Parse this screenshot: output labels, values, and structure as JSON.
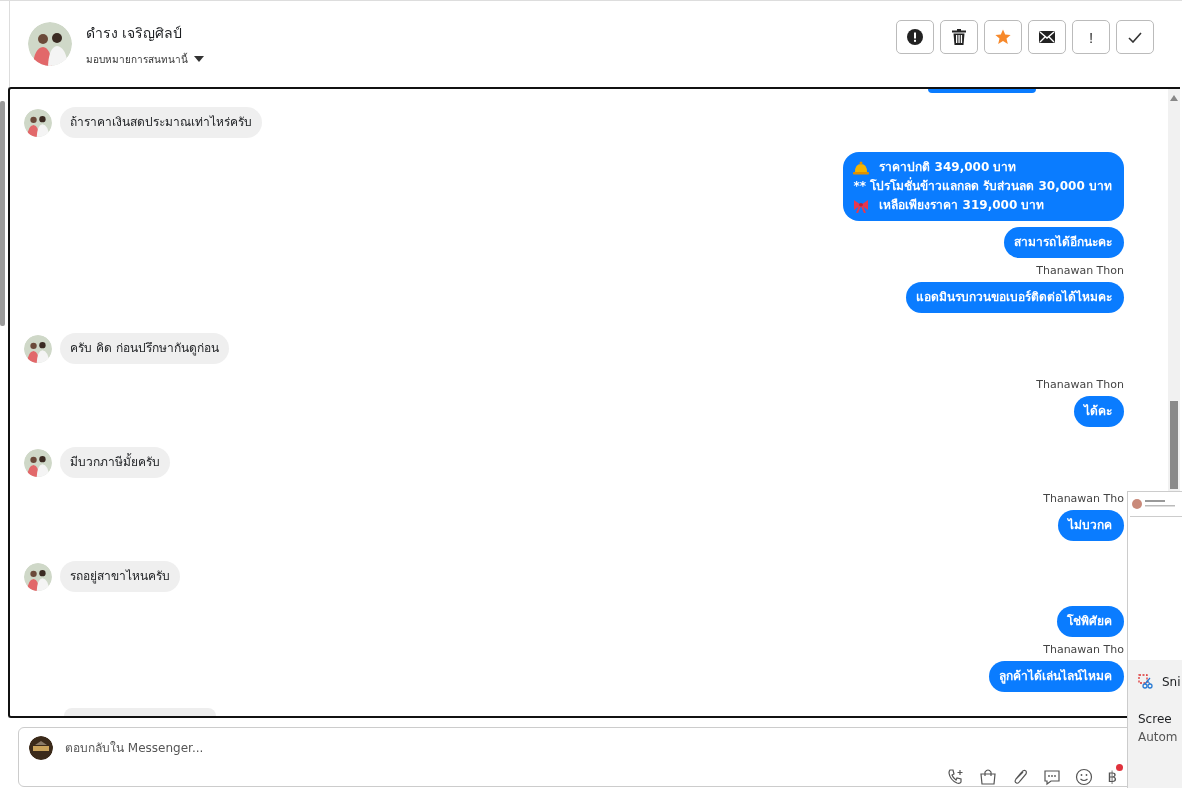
{
  "header": {
    "name": "ดำรง เจริญศิลป์",
    "assign_label": "มอบหมายการสนทนานี้",
    "actions": [
      {
        "kind": "report"
      },
      {
        "kind": "delete"
      },
      {
        "kind": "star",
        "on": true
      },
      {
        "kind": "mail"
      },
      {
        "kind": "important",
        "label": "!"
      },
      {
        "kind": "done"
      }
    ]
  },
  "messages": [
    {
      "kind": "incoming",
      "lines": [
        {
          "text": "ถ้าราคาเงินสดประมาณเท่าไหร่ครับ"
        }
      ]
    },
    {
      "kind": "outgoing",
      "lines": [
        {
          "kind": "bell",
          "text": "ราคาปกติ 349,000 บาท"
        },
        {
          "kind": "plain",
          "text": "** โปรโมชั่นข้าวแลกลด รับส่วนลด 30,000 บาท"
        },
        {
          "kind": "ribbon",
          "text": "เหลือเพียงราคา 319,000 บาท"
        }
      ]
    },
    {
      "kind": "outgoing",
      "lines": [
        {
          "kind": "plain",
          "text": "สามารถได้อีกนะคะ"
        }
      ]
    },
    {
      "kind": "outgoing",
      "sender": "Thanawan Thon",
      "lines": [
        {
          "kind": "plain",
          "text": "แอดมินรบกวนขอเบอร์ติดต่อได้ไหมคะ"
        }
      ]
    },
    {
      "kind": "incoming",
      "lines": [
        {
          "text": "ครับ คิด  ก่อนปรึกษากันดูก่อน"
        }
      ]
    },
    {
      "kind": "outgoing",
      "sender": "Thanawan Thon",
      "lines": [
        {
          "kind": "plain",
          "text": "ได้คะ"
        }
      ]
    },
    {
      "kind": "incoming",
      "lines": [
        {
          "text": "มีบวกภาษีมั้ยครับ"
        }
      ]
    },
    {
      "kind": "outgoing",
      "sender": "Thanawan Tho",
      "lines": [
        {
          "kind": "plain",
          "text": "ไม่บวกค"
        }
      ]
    },
    {
      "kind": "incoming",
      "lines": [
        {
          "text": "รถอยู่สาขาไหนครับ"
        }
      ]
    },
    {
      "kind": "outgoing",
      "lines": [
        {
          "kind": "plain",
          "text": "โช่พิศัยค"
        }
      ]
    },
    {
      "kind": "outgoing",
      "sender": "Thanawan Tho",
      "lines": [
        {
          "kind": "plain",
          "text": "ลูกค้าได้เล่นไลน์ไหมค"
        }
      ]
    }
  ],
  "composer": {
    "placeholder": "ตอบกลับใน Messenger...",
    "currency": "฿"
  },
  "notification": {
    "app": "Sni",
    "title": "Scree",
    "body": "Autom"
  }
}
